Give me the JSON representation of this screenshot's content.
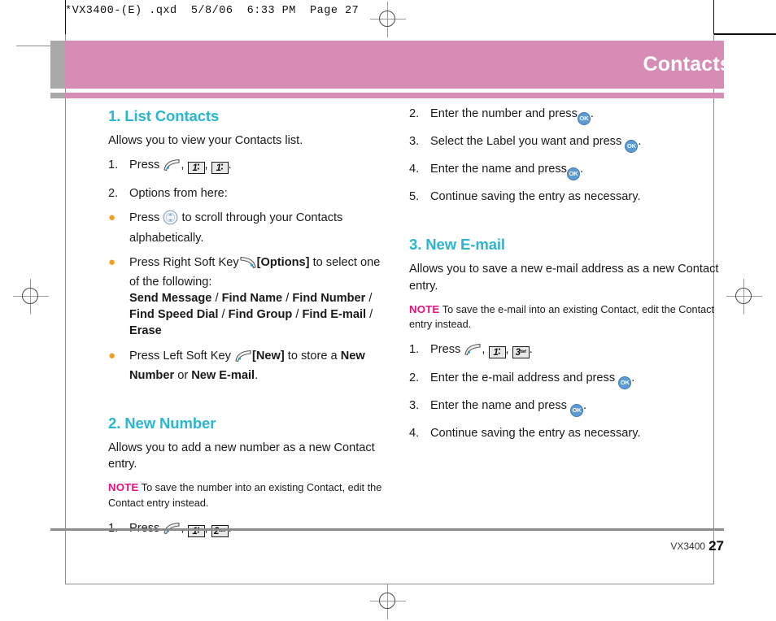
{
  "file_header": "*VX3400-(E) .qxd  5/8/06  6:33 PM  Page 27",
  "chapter": {
    "title": "Contacts",
    "band_color": "#d68cb4",
    "heading_color": "#29b6d0",
    "note_color": "#e4127e",
    "bullet_color": "#f0a01e"
  },
  "left_column": {
    "s1": {
      "heading": "1. List Contacts",
      "intro": "Allows you to view your Contacts list.",
      "step1_marker": "1.",
      "step1_press": "Press",
      "step1_comma1": ",",
      "step1_comma2": ",",
      "step1_period": ".",
      "step1_key1": {
        "digit": "1",
        "sub_top": "o",
        "sub_bottom": "⌂"
      },
      "step1_key2": {
        "digit": "1",
        "sub_top": "o",
        "sub_bottom": "⌂"
      },
      "step2_marker": "2.",
      "step2_text": "Options from here:",
      "b1_pre": "Press",
      "b1_post": "to scroll through your Contacts alphabetically.",
      "b2_pre": "Press Right Soft Key",
      "b2_bracket": "[Options]",
      "b2_post": "to select one of the following:",
      "menu_line1_a": "Send Message",
      "menu_sep1": " / ",
      "menu_line1_b": "Find Name",
      "menu_sep2": " / ",
      "menu_line1_c": "Find Number",
      "menu_sep3": " / ",
      "menu_line2_a": "Find Speed Dial",
      "menu_sep4": " / ",
      "menu_line2_b": "Find Group",
      "menu_sep5": " / ",
      "menu_line2_c": "Find E-mail",
      "menu_sep6": " / ",
      "menu_line3_a": "Erase",
      "b3_pre": "Press Left Soft Key",
      "b3_bracket": "[New]",
      "b3_mid": "to store a",
      "b3_bold1": "New Number",
      "b3_or": "or",
      "b3_bold2": "New E-mail",
      "b3_end": "."
    },
    "s2": {
      "heading": "2. New Number",
      "intro": "Allows you to add a new number as a new Contact entry.",
      "note_label": "NOTE",
      "note_text": "To save the number into an existing Contact, edit the Contact entry instead.",
      "step1_marker": "1.",
      "step1_press": "Press",
      "step1_comma1": ",",
      "step1_comma2": ",",
      "step1_period": ".",
      "step1_key1": {
        "digit": "1",
        "sub_top": "o",
        "sub_bottom": "⌂"
      },
      "step1_key2": {
        "digit": "2",
        "sub": "abc"
      }
    }
  },
  "right_column": {
    "s1_cont": {
      "step2_marker": "2.",
      "step2_pre": "Enter the number and press",
      "step2_post": ".",
      "step3_marker": "3.",
      "step3_pre": "Select the Label you want and press",
      "step3_post": ".",
      "step4_marker": "4.",
      "step4_pre": "Enter the name and press",
      "step4_post": ".",
      "step5_marker": "5.",
      "step5_text": "Continue saving the entry as necessary."
    },
    "s3": {
      "heading": "3. New E-mail",
      "intro": "Allows you to save a new e-mail address as a new Contact entry.",
      "note_label": "NOTE",
      "note_text": "To save the e-mail into an existing Contact, edit the Contact entry instead.",
      "step1_marker": "1.",
      "step1_press": "Press",
      "step1_comma1": ",",
      "step1_comma2": ",",
      "step1_period": ".",
      "step1_key1": {
        "digit": "1",
        "sub_top": "o",
        "sub_bottom": "⌂"
      },
      "step1_key2": {
        "digit": "3",
        "sub": "def"
      },
      "step2_marker": "2.",
      "step2_pre": "Enter the e-mail address and press",
      "step2_post": ".",
      "step3_marker": "3.",
      "step3_pre": "Enter the name and press",
      "step3_post": ".",
      "step4_marker": "4.",
      "step4_text": "Continue saving the entry as necessary."
    }
  },
  "key_labels": {
    "ok": "OK"
  },
  "footer": {
    "model": "VX3400",
    "page": "27"
  }
}
